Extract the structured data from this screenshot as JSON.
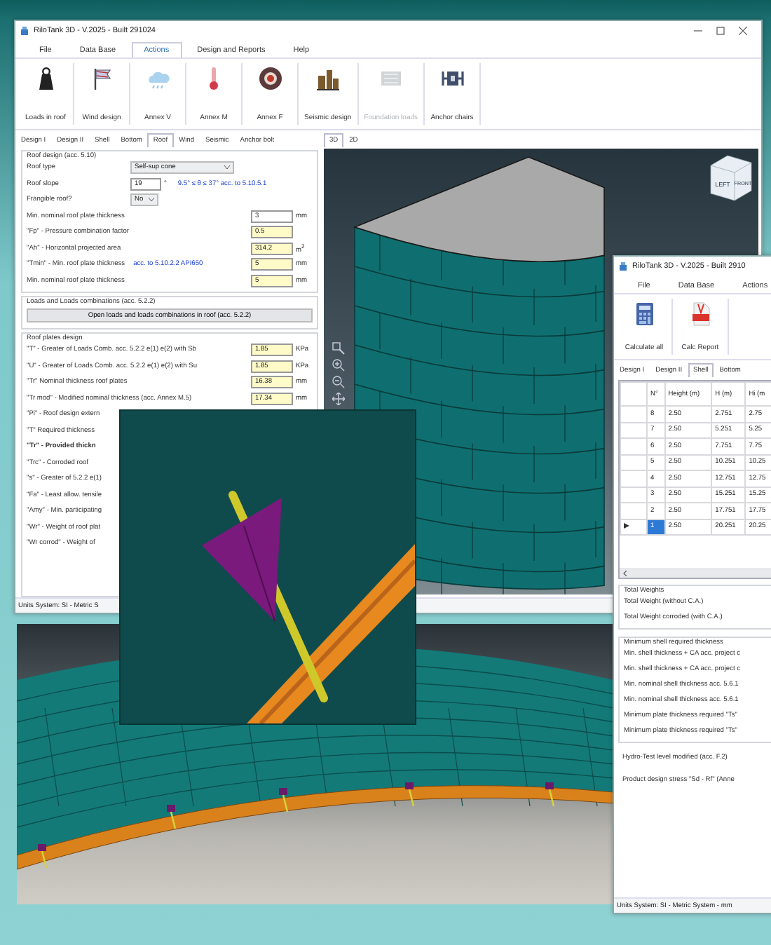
{
  "main_window": {
    "title": "RiloTank 3D - V.2025 - Built 291024",
    "menu": [
      {
        "label": "File",
        "selected": false
      },
      {
        "label": "Data Base",
        "selected": false
      },
      {
        "label": "Actions",
        "selected": true
      },
      {
        "label": "Design and Reports",
        "selected": false
      },
      {
        "label": "Help",
        "selected": false
      }
    ],
    "ribbon": [
      {
        "label": "Loads in roof",
        "disabled": false
      },
      {
        "label": "Wind design",
        "disabled": false
      },
      {
        "label": "Annex V",
        "disabled": false
      },
      {
        "label": "Annex M",
        "disabled": false
      },
      {
        "label": "Annex F",
        "disabled": false
      },
      {
        "label": "Seismic design",
        "disabled": false
      },
      {
        "label": "Foundation loads",
        "disabled": true
      },
      {
        "label": "Anchor chairs",
        "disabled": false
      }
    ],
    "tabs": [
      {
        "label": "Design I",
        "selected": false
      },
      {
        "label": "Design II",
        "selected": false
      },
      {
        "label": "Shell",
        "selected": false
      },
      {
        "label": "Bottom",
        "selected": false
      },
      {
        "label": "Roof",
        "selected": true
      },
      {
        "label": "Wind",
        "selected": false
      },
      {
        "label": "Seismic",
        "selected": false
      },
      {
        "label": "Anchor bolt",
        "selected": false
      }
    ],
    "view_tabs": [
      {
        "label": "3D",
        "selected": true
      },
      {
        "label": "2D",
        "selected": false
      }
    ],
    "view_cube": [
      "LEFT",
      "FRONT"
    ],
    "roof_design": {
      "title": "Roof design (acc. 5.10)",
      "rows": [
        {
          "kind": "select",
          "label": "Roof type",
          "value": "Self-sup cone"
        },
        {
          "kind": "input",
          "label": "Roof slope",
          "value": "19",
          "unit": "°",
          "note": "9.5° ≤ θ ≤ 37° acc. to 5.10.5.1",
          "highlighted": false
        },
        {
          "kind": "select",
          "label": "Frangible roof?",
          "value": "No"
        },
        {
          "kind": "input",
          "label": "Min. nominal roof plate thickness",
          "value": "3",
          "unit": "mm",
          "highlighted": false
        },
        {
          "kind": "input",
          "label": "\"Fp\" - Pressure combination factor",
          "value": "0.5",
          "highlighted": true
        },
        {
          "kind": "input",
          "label": "\"Ah\" - Horizontal projected area",
          "value": "314.2",
          "unit": "m$^{2}$",
          "highlighted": true
        },
        {
          "kind": "input",
          "label": "\"Tmin\" - Min. roof plate thickness",
          "note": "acc. to 5.10.2.2 API650",
          "value": "5",
          "unit": "mm",
          "highlighted": true
        },
        {
          "kind": "input",
          "label": "Min. nominal roof plate thickness",
          "value": "5",
          "unit": "mm",
          "highlighted": true
        }
      ]
    },
    "loads_group": {
      "title": "Loads and Loads combinations (acc. 5.2.2)",
      "button": "Open loads and loads combinations in roof (acc. 5.2.2)"
    },
    "plates_group": {
      "title": "Roof plates design",
      "rows": [
        {
          "kind": "input",
          "label": "\"T\" - Greater of Loads Comb. acc. 5.2.2 e(1) e(2) with Sb",
          "value": "1.85",
          "unit": "KPa",
          "highlighted": true
        },
        {
          "kind": "input",
          "label": "\"U\" - Greater of Loads Comb. acc. 5.2.2 e(1) e(2) with Su",
          "value": "1.85",
          "unit": "KPa",
          "highlighted": true
        },
        {
          "kind": "input",
          "label": "\"Tr\" Nominal thickness roof plates",
          "value": "16.38",
          "unit": "mm",
          "highlighted": true
        },
        {
          "kind": "input",
          "label": "\"Tr mod\" - Modified nominal thickness (acc. Annex M.5)",
          "value": "17.34",
          "unit": "mm",
          "highlighted": true
        },
        {
          "kind": "text",
          "label": "\"Pi\" - Roof design extern",
          "bold": false
        },
        {
          "kind": "text",
          "label": "\"T\" Required thickness",
          "bold": false
        },
        {
          "kind": "text",
          "label": "\"Tr\" - Provided thickn",
          "bold": true
        },
        {
          "kind": "text",
          "label": "\"Trc\" - Corroded roof",
          "bold": false
        },
        {
          "kind": "text",
          "label": "\"s\" - Greater of 5.2.2 e(1)",
          "bold": false
        },
        {
          "kind": "text",
          "label": "\"Fa\" - Least allow. tensile",
          "bold": false
        },
        {
          "kind": "text",
          "label": "\"Amy\" - Min. participating",
          "bold": false
        },
        {
          "kind": "text",
          "label": "\"Wr\" - Weight of roof plat",
          "bold": false
        },
        {
          "kind": "text",
          "label": "\"Wr corrod\" - Weight of",
          "bold": false
        }
      ]
    },
    "status_bar": "Units System: SI - Metric S"
  },
  "right_window": {
    "title": "RiloTank 3D - V.2025 - Built 2910",
    "menu": [
      {
        "label": "File",
        "selected": false
      },
      {
        "label": "Data Base",
        "selected": false
      },
      {
        "label": "Actions",
        "selected": false
      }
    ],
    "ribbon": [
      {
        "label": "Calculate all"
      },
      {
        "label": "Calc Report"
      }
    ],
    "tabs": [
      {
        "label": "Design I",
        "selected": false
      },
      {
        "label": "Design II",
        "selected": false
      },
      {
        "label": "Shell",
        "selected": true
      },
      {
        "label": "Bottom",
        "selected": false
      }
    ],
    "table": {
      "columns": [
        "N°",
        "Height (m)",
        "H (m)",
        "Hi (m"
      ],
      "rows": [
        {
          "cells": [
            "8",
            "2.50",
            "2.751",
            "2.75"
          ],
          "selected": false
        },
        {
          "cells": [
            "7",
            "2.50",
            "5.251",
            "5.25"
          ],
          "selected": false
        },
        {
          "cells": [
            "6",
            "2.50",
            "7.751",
            "7.75"
          ],
          "selected": false
        },
        {
          "cells": [
            "5",
            "2.50",
            "10.251",
            "10.25"
          ],
          "selected": false
        },
        {
          "cells": [
            "4",
            "2.50",
            "12.751",
            "12.75"
          ],
          "selected": false
        },
        {
          "cells": [
            "3",
            "2.50",
            "15.251",
            "15.25"
          ],
          "selected": false
        },
        {
          "cells": [
            "2",
            "2.50",
            "17.751",
            "17.75"
          ],
          "selected": false
        },
        {
          "cells": [
            "1",
            "2.50",
            "20.251",
            "20.25"
          ],
          "selected": true
        }
      ]
    },
    "groups": [
      {
        "title": "Total Weights",
        "rows": [
          "Total Weight (without C.A.)",
          "Total Weight corroded (with C.A.)"
        ]
      },
      {
        "title": "Minimum shell required thickness",
        "rows": [
          "Min. shell thickness + CA acc. project c",
          "Min. shell thickness + CA acc. project c",
          "Min. nominal shell thickness acc. 5.6.1",
          "Min. nominal shell thickness acc. 5.6.1",
          "Minimum plate thickness required \"Ts\"",
          "Minimum plate thickness required \"Ts\""
        ]
      }
    ],
    "extra_rows": [
      "Hydro-Test level modified (acc. F.2)",
      "Product design stress \"Sd - Rf\" (Anne"
    ],
    "status_bar": "Units System: SI - Metric System - mm"
  }
}
